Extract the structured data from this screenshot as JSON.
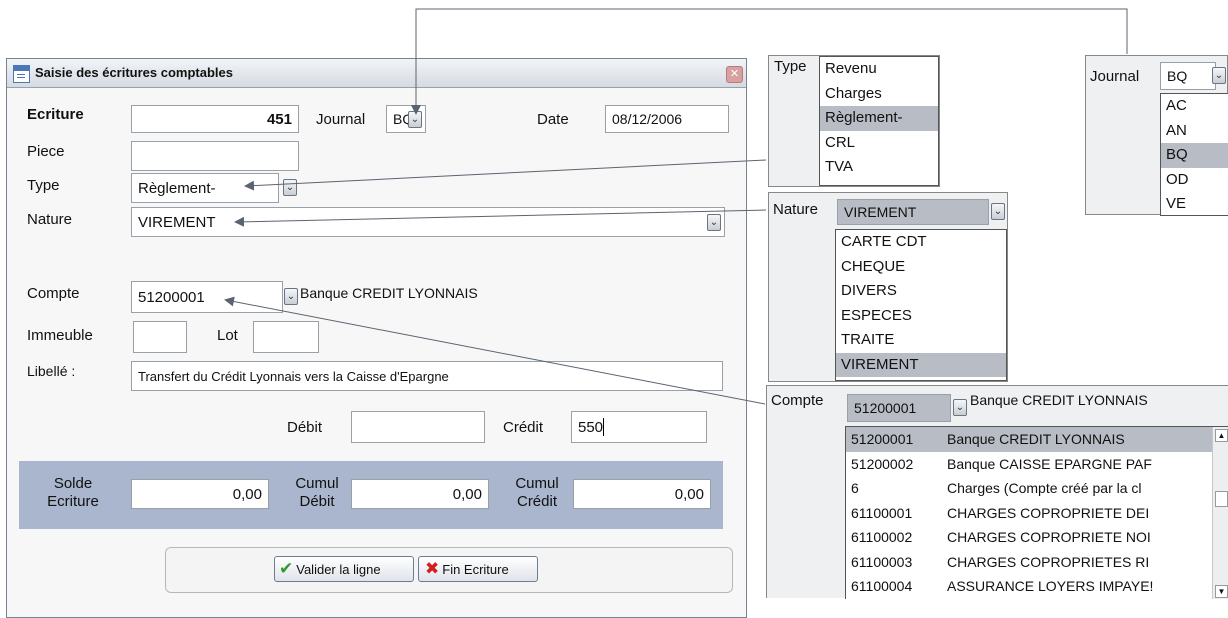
{
  "window": {
    "title": "Saisie des écritures comptables"
  },
  "form": {
    "ecriture_label": "Ecriture",
    "ecriture_value": "451",
    "journal_label": "Journal",
    "journal_value": "BQ",
    "date_label": "Date",
    "date_value": "08/12/2006",
    "piece_label": "Piece",
    "piece_value": "",
    "type_label": "Type",
    "type_value": "Règlement-",
    "nature_label": "Nature",
    "nature_value": "VIREMENT",
    "compte_label": "Compte",
    "compte_value": "51200001",
    "compte_name": "Banque CREDIT LYONNAIS",
    "immeuble_label": "Immeuble",
    "immeuble_value": "",
    "lot_label": "Lot",
    "lot_value": "",
    "libelle_label": "Libellé :",
    "libelle_value": "Transfert du Crédit Lyonnais vers la Caisse d'Epargne",
    "debit_label": "Débit",
    "debit_value": "",
    "credit_label": "Crédit",
    "credit_value": "550"
  },
  "totals": {
    "solde_label_1": "Solde",
    "solde_label_2": "Ecriture",
    "solde_value": "0,00",
    "cumul_debit_label_1": "Cumul",
    "cumul_debit_label_2": "Débit",
    "cumul_debit_value": "0,00",
    "cumul_credit_label_1": "Cumul",
    "cumul_credit_label_2": "Crédit",
    "cumul_credit_value": "0,00"
  },
  "buttons": {
    "valider": "Valider la ligne",
    "fin": "Fin Ecriture"
  },
  "type_popup": {
    "label": "Type",
    "items": [
      "Revenu",
      "Charges",
      "Règlement-",
      "CRL",
      "TVA"
    ],
    "selected": "Règlement-"
  },
  "journal_popup": {
    "label": "Journal",
    "value": "BQ",
    "items": [
      "AC",
      "AN",
      "BQ",
      "OD",
      "VE"
    ],
    "selected": "BQ"
  },
  "nature_popup": {
    "label": "Nature",
    "value": "VIREMENT",
    "items": [
      "CARTE CDT",
      "CHEQUE",
      "DIVERS",
      "ESPECES",
      "TRAITE",
      "VIREMENT"
    ],
    "selected": "VIREMENT"
  },
  "compte_popup": {
    "label": "Compte",
    "value": "51200001",
    "name": "Banque CREDIT LYONNAIS",
    "rows": [
      {
        "code": "51200001",
        "name": "Banque CREDIT LYONNAIS"
      },
      {
        "code": "51200002",
        "name": "Banque CAISSE EPARGNE PAF"
      },
      {
        "code": "6",
        "name": "Charges (Compte créé par la cl"
      },
      {
        "code": "61100001",
        "name": "CHARGES COPROPRIETE DEI"
      },
      {
        "code": "61100002",
        "name": "CHARGES COPROPRIETE NOI"
      },
      {
        "code": "61100003",
        "name": "CHARGES COPROPRIETES RI"
      },
      {
        "code": "61100004",
        "name": "ASSURANCE LOYERS IMPAYE!"
      }
    ],
    "selected": "51200001"
  },
  "colors": {
    "titlebar": "#dfe3e9",
    "totals_band": "#a9b6cd",
    "selection": "#b8bcc4",
    "arrow": "#5a6470"
  }
}
